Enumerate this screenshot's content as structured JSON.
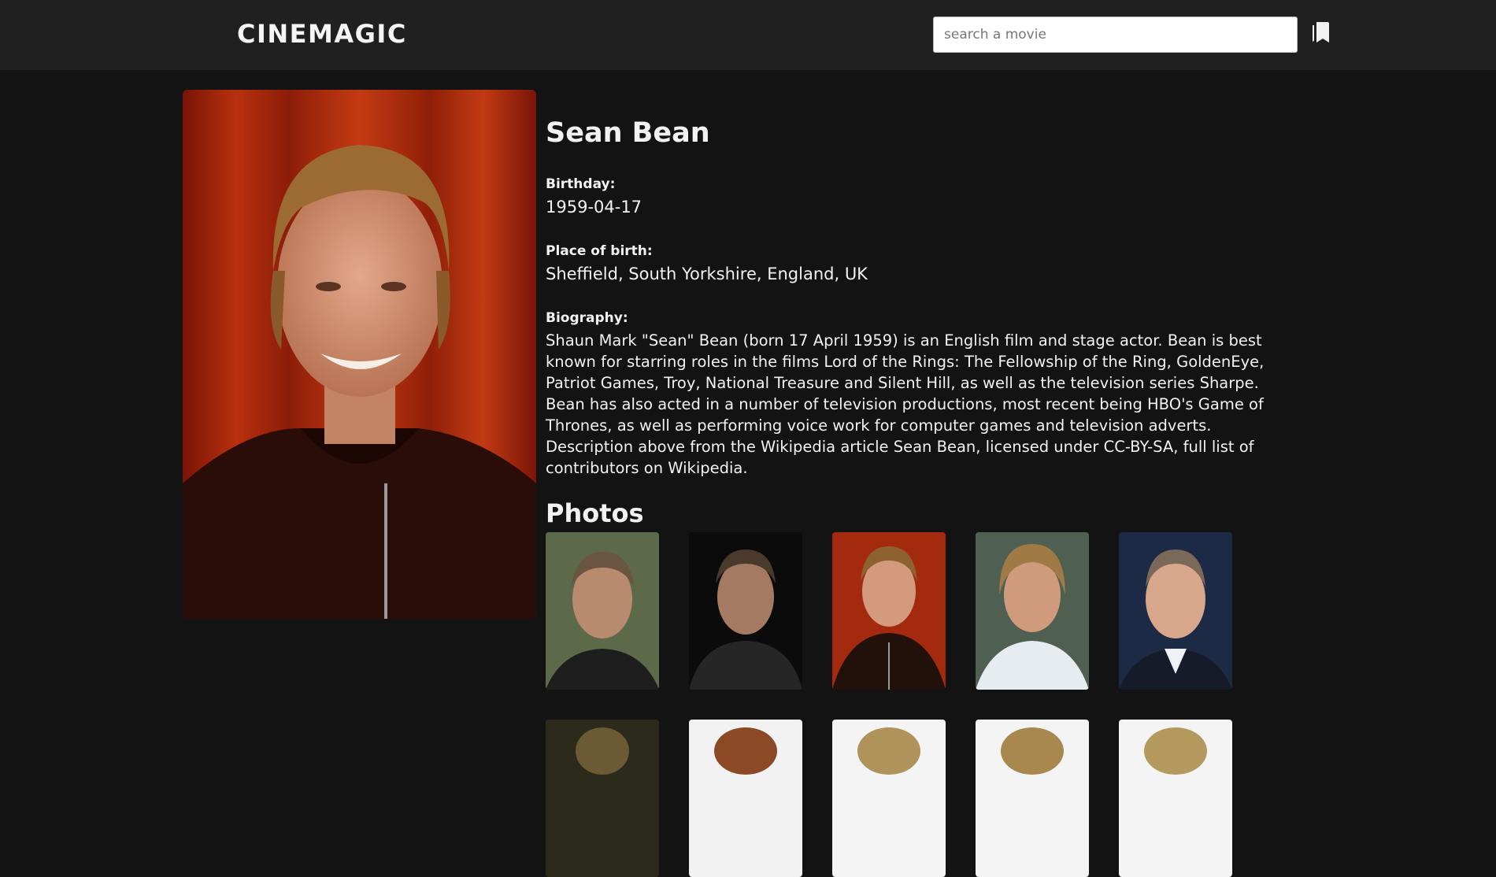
{
  "header": {
    "logo": "CINEMAGIC",
    "search_placeholder": "search a movie",
    "bookmark_icon": "bookmark-icon"
  },
  "person": {
    "name": "Sean Bean",
    "birthday_label": "Birthday:",
    "birthday": "1959-04-17",
    "place_label": "Place of birth:",
    "place": "Sheffield, South Yorkshire, England, UK",
    "bio_label": "Biography:",
    "biography": "Shaun Mark \"Sean\" Bean (born 17 April 1959) is an English film and stage actor. Bean is best known for starring roles in the films Lord of the Rings: The Fellowship of the Ring, GoldenEye, Patriot Games, Troy, National Treasure and Silent Hill, as well as the television series Sharpe. Bean has also acted in a number of television productions, most recent being HBO's Game of Thrones, as well as performing voice work for computer games and television adverts. Description above from the Wikipedia article Sean Bean, licensed under CC-BY-SA, full list of contributors on Wikipedia."
  },
  "photos": {
    "title": "Photos"
  },
  "colors": {
    "background": "#131313",
    "header": "#202020",
    "text": "#f2f2f2"
  }
}
